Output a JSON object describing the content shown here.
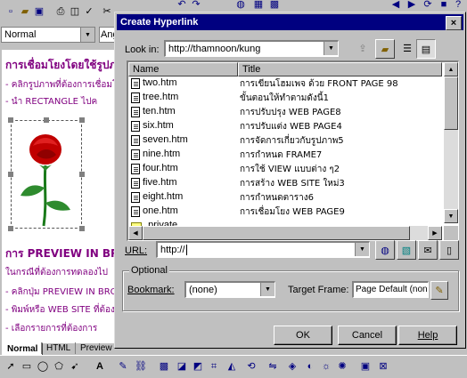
{
  "app": {
    "style_value": "Normal",
    "font_value": "Ang",
    "doc_lines": [
      "การเชื่อมโยงโดยใช้รูปภ",
      "- คลิกรูปภาพที่ต้องการเชื่อมโยง",
      "- นำ RECTANGLE ไปค",
      "การ PREVIEW IN BR",
      "ในกรณีที่ต้องการทดลองไป",
      "- คลิกปุ่ม PREVIEW IN BRO",
      "- พิมพ์หรือ WEB SITE ที่ต้องก",
      "- เลือกรายการที่ต้องการ"
    ],
    "tabs": [
      "Normal",
      "HTML",
      "Preview"
    ]
  },
  "dialog": {
    "title": "Create Hyperlink",
    "close_glyph": "×",
    "look_in_label": "Look in:",
    "look_in_value": "http://thamnoon/kung",
    "columns": [
      "Name",
      "Title"
    ],
    "files": [
      {
        "name": "two.htm",
        "title": "การเขียนโฮมเพจ ด้วย FRONT PAGE 98"
      },
      {
        "name": "tree.htm",
        "title": "ขั้นตอนให้ทำตามดังนี้1"
      },
      {
        "name": "ten.htm",
        "title": "การปรับปรุง WEB PAGE8"
      },
      {
        "name": "six.htm",
        "title": "การปรับแต่ง WEB PAGE4"
      },
      {
        "name": "seven.htm",
        "title": "การจัดการเกี่ยวกับรูปภาพ5"
      },
      {
        "name": "nine.htm",
        "title": "การกำหนด FRAME7"
      },
      {
        "name": "four.htm",
        "title": "การใช้ VIEW แบบต่าง ๆ2"
      },
      {
        "name": "five.htm",
        "title": "การสร้าง WEB SITE ใหม่3"
      },
      {
        "name": "eight.htm",
        "title": "การกำหนดตาราง6"
      },
      {
        "name": "one.htm",
        "title": "การเชื่อมโยง WEB PAGE9"
      },
      {
        "name": "_private",
        "title": ""
      }
    ],
    "url_label": "URL:",
    "url_value": "http://",
    "optional_label": "Optional",
    "bookmark_label": "Bookmark:",
    "bookmark_value": "(none)",
    "target_label": "Target Frame:",
    "target_value": "Page Default (none)",
    "ok_label": "OK",
    "cancel_label": "Cancel",
    "help_label": "Help"
  },
  "colors": {
    "titlebar": "#000080",
    "doc_text": "#800080"
  }
}
